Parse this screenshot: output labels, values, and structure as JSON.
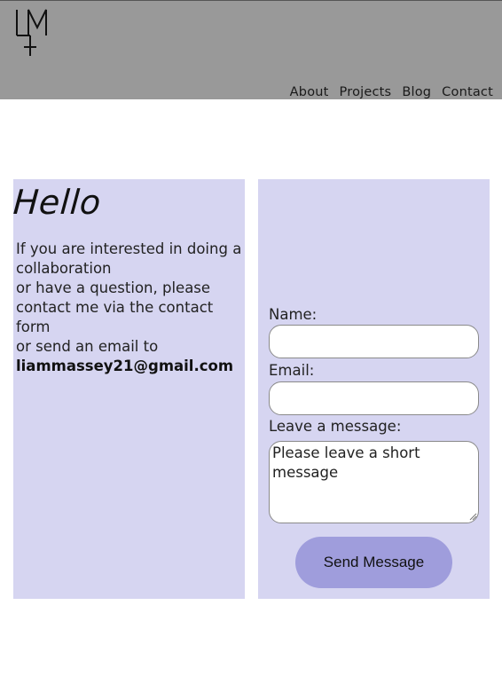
{
  "header": {
    "logo_icon": "lm-monogram-logo",
    "nav": [
      {
        "label": "About"
      },
      {
        "label": "Projects"
      },
      {
        "label": "Blog"
      },
      {
        "label": "Contact"
      }
    ]
  },
  "intro": {
    "heading": "Hello",
    "lines": [
      "If you are interested in doing a collaboration",
      "or have a question, please contact me via the contact form",
      "or send an email to"
    ],
    "email": "liammassey21@gmail.com"
  },
  "form": {
    "name_label": "Name:",
    "name_value": "",
    "email_label": "Email:",
    "email_value": "",
    "message_label": "Leave a message:",
    "message_placeholder": "Please leave a short message",
    "submit_label": "Send Message"
  },
  "colors": {
    "header_bg": "#999999",
    "card_bg": "#d6d5f1",
    "button_bg": "#9f9ddc"
  }
}
